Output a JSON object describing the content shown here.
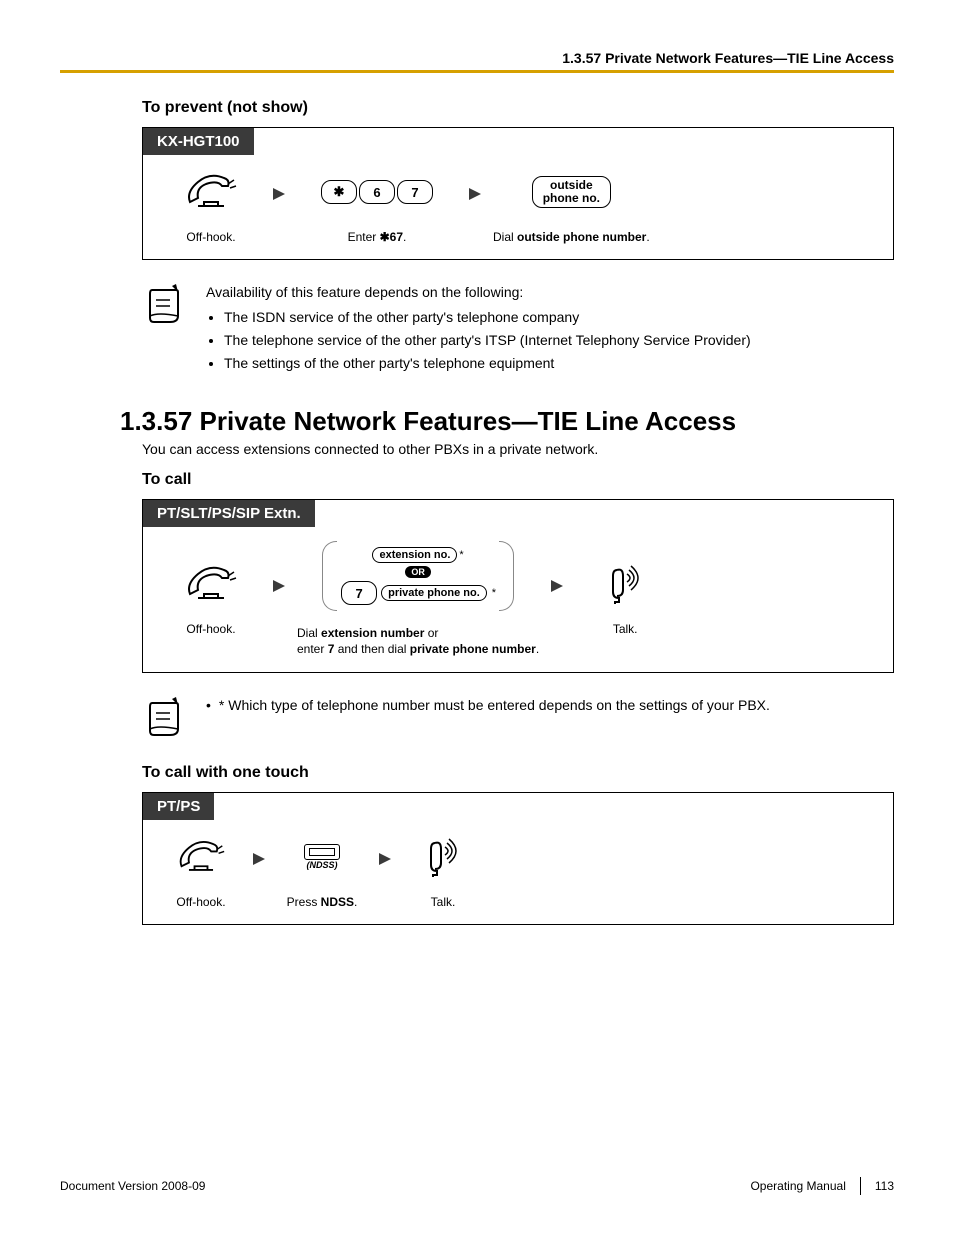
{
  "header": {
    "breadcrumb": "1.3.57 Private Network Features—TIE Line Access"
  },
  "sec_prevent": {
    "title": "To prevent (not show)",
    "tab": "KX-HGT100",
    "step1_label": "Off-hook.",
    "step2_label_pre": "Enter ",
    "step2_label_code": "✱67",
    "step2_label_post": ".",
    "key_star": "✱",
    "key_6": "6",
    "key_7": "7",
    "pill_outside_l1": "outside",
    "pill_outside_l2": "phone no.",
    "step3_label_pre": "Dial ",
    "step3_label_bold": "outside phone number",
    "step3_label_post": "."
  },
  "note1": {
    "intro": "Availability of this feature depends on the following:",
    "b1": "The ISDN service of the other party's telephone company",
    "b2": "The telephone service of the other party's ITSP (Internet Telephony Service Provider)",
    "b3": "The settings of the other party's telephone equipment"
  },
  "heading": "1.3.57  Private Network Features—TIE Line Access",
  "intro": "You can access extensions connected to other PBXs in a private network.",
  "sec_call": {
    "title": "To call",
    "tab": "PT/SLT/PS/SIP Extn.",
    "step1_label": "Off-hook.",
    "pill_ext": "extension no.",
    "or": "OR",
    "key_7": "7",
    "pill_priv": "private phone no.",
    "step2_l1_pre": "Dial ",
    "step2_l1_bold": "extension number",
    "step2_l1_post": " or",
    "step2_l2_pre": "enter ",
    "step2_l2_bold1": "7",
    "step2_l2_mid": " and then dial ",
    "step2_l2_bold2": "private phone number",
    "step2_l2_post": ".",
    "step3_label": "Talk."
  },
  "note2": {
    "bullet": "* Which type of telephone number must be entered depends on the settings of your PBX."
  },
  "sec_onetouch": {
    "title": "To call with one touch",
    "tab": "PT/PS",
    "step1_label": "Off-hook.",
    "ndss": "(NDSS)",
    "step2_pre": "Press ",
    "step2_bold": "NDSS",
    "step2_post": ".",
    "step3_label": "Talk."
  },
  "footer": {
    "left": "Document Version  2008-09",
    "right_label": "Operating Manual",
    "page": "113"
  }
}
